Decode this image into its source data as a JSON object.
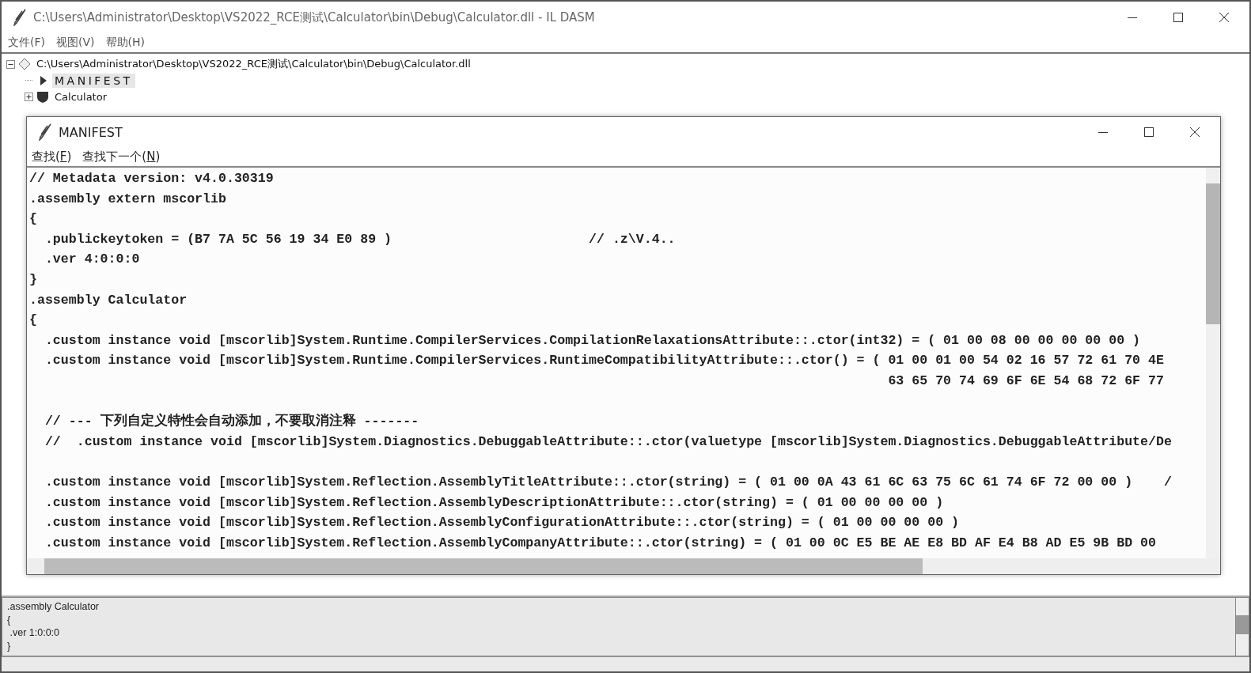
{
  "window": {
    "title": "C:\\Users\\Administrator\\Desktop\\VS2022_RCE测试\\Calculator\\bin\\Debug\\Calculator.dll - IL DASM"
  },
  "menu": [
    {
      "label": "文件(F)"
    },
    {
      "label": "视图(V)"
    },
    {
      "label": "帮助(H)"
    }
  ],
  "tree": [
    {
      "kind": "module",
      "label": "C:\\Users\\Administrator\\Desktop\\VS2022_RCE测试\\Calculator\\bin\\Debug\\Calculator.dll",
      "expanded": true,
      "selected": false,
      "children": [
        {
          "kind": "manifest",
          "label": "MANIFEST",
          "selected": true
        },
        {
          "kind": "namespace",
          "label": "Calculator",
          "expanded": false,
          "selected": false
        }
      ]
    }
  ],
  "manifest_window": {
    "title": "MANIFEST",
    "menu": [
      {
        "before": "查找(",
        "key": "F",
        "after": ")"
      },
      {
        "before": "查找下一个(",
        "key": "N",
        "after": ")"
      }
    ],
    "blocks": [
      {
        "lines": [
          "// Metadata version: v4.0.30319",
          ".assembly extern mscorlib",
          "{",
          "  .publickeytoken = (B7 7A 5C 56 19 34 E0 89 )                         // .z\\V.4..",
          "  .ver 4:0:0:0",
          "}",
          ".assembly Calculator",
          "{",
          "  .custom instance void [mscorlib]System.Runtime.CompilerServices.CompilationRelaxationsAttribute::.ctor(int32) = ( 01 00 08 00 00 00 00 00 )",
          "  .custom instance void [mscorlib]System.Runtime.CompilerServices.RuntimeCompatibilityAttribute::.ctor() = ( 01 00 01 00 54 02 16 57 72 61 70 4E",
          "                                                                                                             63 65 70 74 69 6F 6E 54 68 72 6F 77"
        ]
      },
      {
        "lines": [
          "  // --- 下列自定义特性会自动添加，不要取消注释 -------",
          "  //  .custom instance void [mscorlib]System.Diagnostics.DebuggableAttribute::.ctor(valuetype [mscorlib]System.Diagnostics.DebuggableAttribute/De"
        ]
      },
      {
        "lines": [
          "  .custom instance void [mscorlib]System.Reflection.AssemblyTitleAttribute::.ctor(string) = ( 01 00 0A 43 61 6C 63 75 6C 61 74 6F 72 00 00 )    /",
          "  .custom instance void [mscorlib]System.Reflection.AssemblyDescriptionAttribute::.ctor(string) = ( 01 00 00 00 00 )",
          "  .custom instance void [mscorlib]System.Reflection.AssemblyConfigurationAttribute::.ctor(string) = ( 01 00 00 00 00 )",
          "  .custom instance void [mscorlib]System.Reflection.AssemblyCompanyAttribute::.ctor(string) = ( 01 00 0C E5 BE AE E8 BD AF E4 B8 AD E5 9B BD 00"
        ]
      }
    ]
  },
  "output_pane": {
    "lines": [
      ".assembly Calculator",
      "{",
      " .ver 1:0:0:0",
      "}"
    ]
  }
}
